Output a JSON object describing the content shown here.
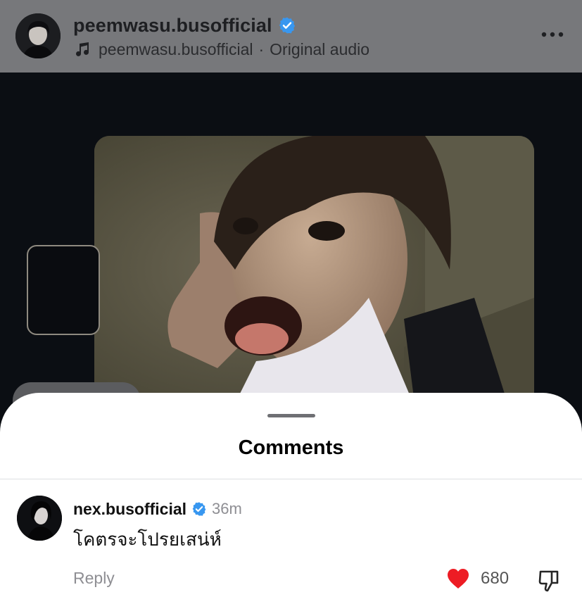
{
  "header": {
    "username": "peemwasu.busofficial",
    "audio_owner": "peemwasu.busofficial",
    "audio_separator": "·",
    "audio_title": "Original audio",
    "verified_color": "#3897f0",
    "icons": [
      "music-note-icon",
      "verified-badge-icon",
      "more-options-icon"
    ]
  },
  "comments_sheet": {
    "title": "Comments",
    "comment": {
      "username": "nex.busofficial",
      "time": "36m",
      "text": "โคตรจะโปรยเสน่ห์",
      "reply_label": "Reply",
      "like_count": "680",
      "liked": true,
      "like_color": "#ed1c24"
    }
  }
}
